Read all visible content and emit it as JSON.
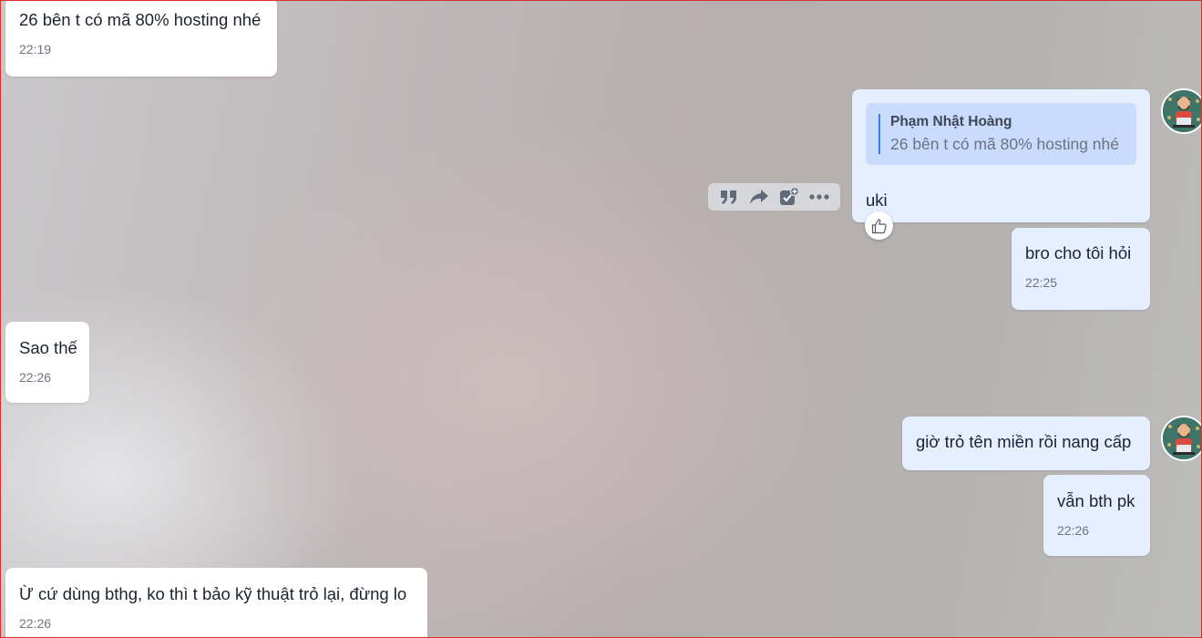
{
  "messages": [
    {
      "text": "26 bên t có mã 80% hosting nhé",
      "time": "22:19"
    },
    {
      "quote_author": "Phạm Nhật Hoàng",
      "quote_text": "26 bên t có mã 80% hosting nhé",
      "text": "uki"
    },
    {
      "text": "bro cho tôi hỏi",
      "time": "22:25"
    },
    {
      "text": "Sao thế",
      "time": "22:26"
    },
    {
      "text": "giờ trỏ tên miền rồi nang cấp"
    },
    {
      "text": "vẫn bth pk",
      "time": "22:26"
    },
    {
      "text": "Ừ cứ dùng bthg, ko thì t bảo kỹ thuật trỏ lại, đừng lo",
      "time": "22:26"
    }
  ],
  "toolbar": {
    "icons": [
      "quote-icon",
      "forward-icon",
      "add-task-icon",
      "more-icon"
    ]
  },
  "reaction": {
    "icon": "thumbs-up-icon"
  },
  "colors": {
    "incoming_bubble": "#ffffff",
    "outgoing_bubble": "#e5efff",
    "quote_background": "#c9dcfd",
    "quote_bar": "#3d7be6"
  }
}
